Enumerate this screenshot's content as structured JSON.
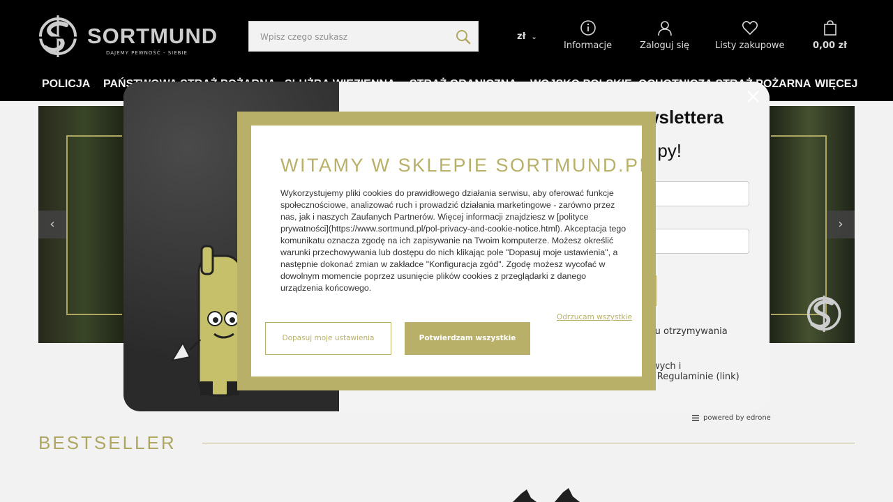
{
  "header": {
    "logo_text": "SORTMUND",
    "logo_tagline": "DAJEMY PEWNOŚĆ - SIEBIE",
    "search_placeholder": "Wpisz czego szukasz",
    "currency": "zł",
    "info_label": "Informacje",
    "login_label": "Zaloguj się",
    "wishlist_label": "Listy zakupowe",
    "cart_label": "0,00 zł"
  },
  "nav": {
    "items": [
      "POLICJA",
      "PAŃSTWOWA STRAŻ POŻARNA",
      "SŁUŻBA WIĘZIENNA",
      "STRAŻ GRANICZNA",
      "WOJSKO POLSKIE",
      "OCHOTNICZA STRAŻ POŻARNA",
      "WIĘCEJ"
    ]
  },
  "main": {
    "bestseller_title": "BESTSELLER",
    "slider_prev": "‹",
    "slider_next": "›"
  },
  "newsletter": {
    "title": "newslettera",
    "subtitle": "py!",
    "close": "×",
    "consent_line1": "elu otrzymywania",
    "consent_line2": "owych i",
    "consent_line3": "w Regulaminie (link)",
    "powered_by": "powered by edrone"
  },
  "cookie": {
    "title": "WITAMY W SKLEPIE SORTMUND.PL",
    "body": "Wykorzystujemy pliki cookies do prawidłowego działania serwisu, aby oferować funkcje społecznościowe, analizować ruch i prowadzić działania marketingowe - zarówno przez nas, jak i naszych Zaufanych Partnerów. Więcej informacji znajdziesz w [polityce prywatności](https://www.sortmund.pl/pol-privacy-and-cookie-notice.html). Akceptacja tego komunikatu oznacza zgodę na ich zapisywanie na Twoim komputerze. Możesz określić warunki przechowywania lub dostępu do nich klikając pole \"Dopasuj moje ustawienia\", a następnie dokonać zmian w zakładce \"Konfiguracja zgód\". Zgodę możesz wycofać w dowolnym momencie poprzez usunięcie plików cookies z przeglądarki z danego urządzenia końcowego.",
    "reject_all": "Odrzucam wszystkie",
    "customize": "Dopasuj moje ustawienia",
    "accept_all": "Potwierdzam wszystkie"
  },
  "colors": {
    "accent": "#b8b068",
    "header_bg": "#000000"
  }
}
